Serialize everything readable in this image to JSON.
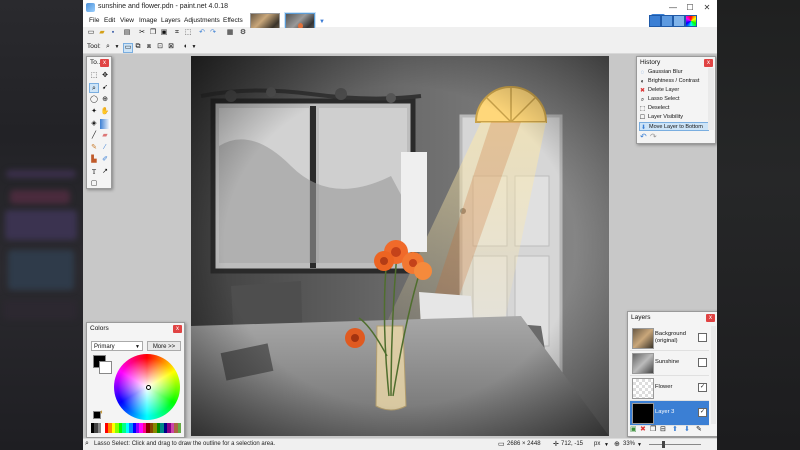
{
  "window": {
    "title": "sunshine and flower.pdn - paint.net 4.0.18",
    "minimize": "—",
    "maximize": "☐",
    "close": "✕"
  },
  "menu": [
    "File",
    "Edit",
    "View",
    "Image",
    "Layers",
    "Adjustments",
    "Effects"
  ],
  "toolbar": {
    "tool_label": "Tool:"
  },
  "tools_panel": {
    "title": "To...",
    "close": "x"
  },
  "history": {
    "title": "History",
    "close": "x",
    "items": [
      {
        "icon": "gaussian-blur-icon",
        "label": "Gaussian Blur"
      },
      {
        "icon": "brightness-contrast-icon",
        "label": "Brightness / Contrast"
      },
      {
        "icon": "delete-layer-icon",
        "label": "Delete Layer"
      },
      {
        "icon": "lasso-select-icon",
        "label": "Lasso Select"
      },
      {
        "icon": "deselect-icon",
        "label": "Deselect"
      },
      {
        "icon": "layer-visibility-icon",
        "label": "Layer Visibility"
      },
      {
        "icon": "move-layer-icon",
        "label": "Move Layer to Bottom"
      }
    ],
    "selected_index": 6
  },
  "colors": {
    "title": "Colors",
    "close": "x",
    "mode_select": "Primary",
    "more_button": "More >>",
    "primary": "#000000",
    "secondary": "#ffffff"
  },
  "layers": {
    "title": "Layers",
    "close": "x",
    "items": [
      {
        "name": "Background\n(original)",
        "visible": false,
        "selected": false
      },
      {
        "name": "Sunshine",
        "visible": false,
        "selected": false
      },
      {
        "name": "Flower",
        "visible": true,
        "selected": false
      },
      {
        "name": "Layer 3",
        "visible": true,
        "selected": true
      }
    ]
  },
  "status": {
    "hint": "Lasso Select: Click and drag to draw the outline for a selection area.",
    "image_size": "2686 × 2448",
    "cursor": "712, -15",
    "units": "px",
    "zoom": "33%"
  }
}
